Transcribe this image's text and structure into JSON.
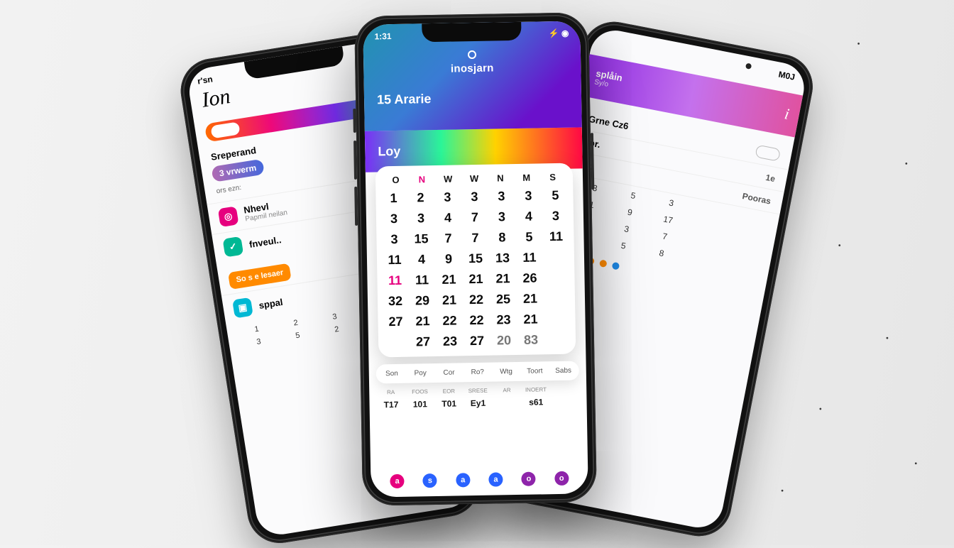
{
  "left": {
    "status_time": "r'sn",
    "heading": "Ion",
    "section1_title": "Sreperand",
    "chip": "3 vrwerm",
    "chip_sub": "ors ezn:",
    "items": [
      {
        "color": "#e6007e",
        "title": "Nhevl",
        "sub": "Papmil neilan"
      },
      {
        "color": "#00b894",
        "title": "fnveul..",
        "sub": ""
      }
    ],
    "tag": "So s e  lesaer",
    "item3": {
      "color": "#00b8d4",
      "title": "sppal",
      "sub": ""
    },
    "grid": [
      "1",
      "2",
      "3",
      "2",
      "3",
      "3",
      "5",
      "2",
      "7",
      "3"
    ]
  },
  "right": {
    "status_right": "M0J",
    "band_left": "splåin",
    "band_sub": "Sy/o",
    "band_right": "i",
    "rows": [
      {
        "l": "Grne  Cz6",
        "r": ""
      },
      {
        "l": "1pr.",
        "r": "1e"
      },
      {
        "l": "tub",
        "r": "Pooras"
      }
    ],
    "grid_headers": [
      "",
      "",
      "",
      "",
      ""
    ],
    "grid": [
      "3",
      "5",
      "3",
      "",
      "",
      "1",
      "9",
      "17",
      "",
      "",
      "0",
      "3",
      "7",
      "",
      "",
      "5",
      "5",
      "8",
      "",
      ""
    ]
  },
  "center": {
    "status_time": "1:31",
    "status_right": "⚡ ◉",
    "app_name": "inosjarn",
    "date_label": "15  Ararie",
    "view_label": "Loy",
    "week": [
      "O",
      "N",
      "W",
      "W",
      "N",
      "M",
      "S"
    ],
    "week_selected_index": 1,
    "days": [
      [
        "1",
        "2",
        "3",
        "3",
        "3",
        "3",
        "5"
      ],
      [
        "3",
        "3",
        "4",
        "7",
        "3",
        "4",
        "3"
      ],
      [
        "3",
        "15",
        "7",
        "7",
        "8",
        "5",
        "11"
      ],
      [
        "11",
        "4",
        "9",
        "15",
        "13",
        "11",
        ""
      ],
      [
        "11",
        "11",
        "21",
        "21",
        "21",
        "26",
        ""
      ],
      [
        "32",
        "29",
        "21",
        "22",
        "25",
        "21",
        ""
      ],
      [
        "27",
        "21",
        "22",
        "22",
        "23",
        "21",
        ""
      ],
      [
        "",
        "27",
        "23",
        "27",
        "20",
        "83",
        ""
      ]
    ],
    "days_highlight": [
      [
        4,
        0
      ]
    ],
    "days_dim": [
      [
        7,
        4
      ],
      [
        7,
        5
      ]
    ],
    "tabs": [
      "Son",
      "Poy",
      "Cor",
      "Ro?",
      "Wtg",
      "Toort",
      "Sabs"
    ],
    "table_headers": [
      "Ra",
      "Foos",
      "Eor",
      "srese",
      "ar",
      "Inoert",
      ""
    ],
    "table_values": [
      "T17",
      "101",
      "T01",
      "Ey1",
      "",
      "s61",
      ""
    ]
  }
}
